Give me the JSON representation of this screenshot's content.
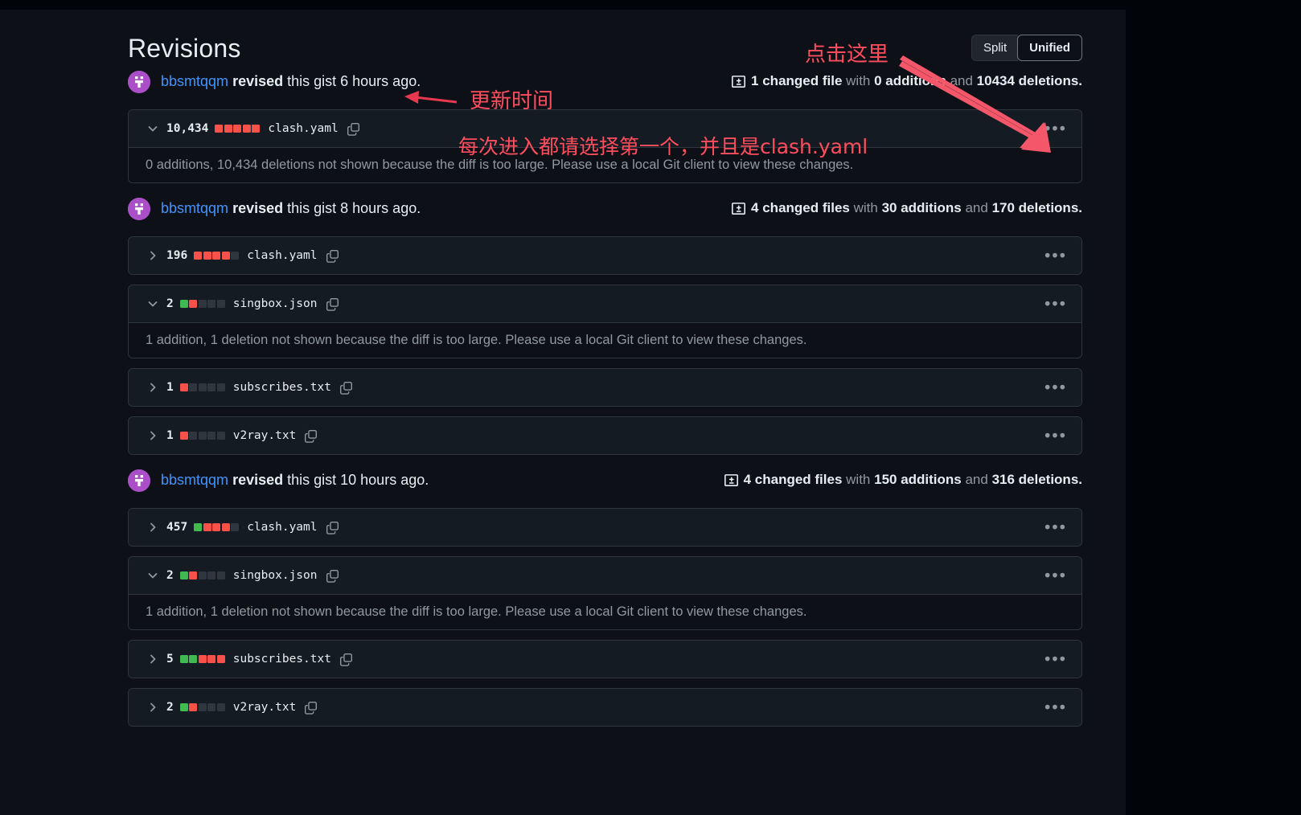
{
  "page": {
    "title": "Revisions"
  },
  "view_toggle": {
    "split_label": "Split",
    "unified_label": "Unified",
    "active": "Unified"
  },
  "colors": {
    "background": "#0d1117",
    "surface": "#151b23",
    "border": "#30363d",
    "link": "#4493f8",
    "text": "#e6edf3",
    "muted": "#9198a1",
    "addition": "#3fb950",
    "deletion": "#f85149",
    "neutral_block": "#30363d",
    "annotation": "#ff4d5e",
    "avatar": "#a544c4"
  },
  "annotations": [
    {
      "id": "update-time",
      "text": "更新时间"
    },
    {
      "id": "click-here",
      "text": "点击这里"
    },
    {
      "id": "choose-first",
      "text": "每次进入都请选择第一个，并且是clash.yaml"
    }
  ],
  "revisions": [
    {
      "author": "bbsmtqqm",
      "action": "revised",
      "middle": " this gist ",
      "time": "6 hours ago.",
      "stat": {
        "files": "1 changed file",
        "with": " with ",
        "additions": "0 additions",
        "and": " and ",
        "deletions": "10434 deletions."
      },
      "files": [
        {
          "expanded": true,
          "count": "10,434",
          "blocks": [
            "del",
            "del",
            "del",
            "del",
            "del"
          ],
          "name": "clash.yaml",
          "message": "0 additions, 10,434 deletions not shown because the diff is too large. Please use a local Git client to view these changes."
        }
      ]
    },
    {
      "author": "bbsmtqqm",
      "action": "revised",
      "middle": " this gist ",
      "time": "8 hours ago.",
      "stat": {
        "files": "4 changed files",
        "with": " with ",
        "additions": "30 additions",
        "and": " and ",
        "deletions": "170 deletions."
      },
      "files": [
        {
          "expanded": false,
          "count": "196",
          "blocks": [
            "del",
            "del",
            "del",
            "del",
            "neu"
          ],
          "name": "clash.yaml",
          "message": null
        },
        {
          "expanded": true,
          "count": "2",
          "blocks": [
            "add",
            "del",
            "neu",
            "neu",
            "neu"
          ],
          "name": "singbox.json",
          "message": "1 addition, 1 deletion not shown because the diff is too large. Please use a local Git client to view these changes."
        },
        {
          "expanded": false,
          "count": "1",
          "blocks": [
            "del",
            "neu",
            "neu",
            "neu",
            "neu"
          ],
          "name": "subscribes.txt",
          "message": null
        },
        {
          "expanded": false,
          "count": "1",
          "blocks": [
            "del",
            "neu",
            "neu",
            "neu",
            "neu"
          ],
          "name": "v2ray.txt",
          "message": null
        }
      ]
    },
    {
      "author": "bbsmtqqm",
      "action": "revised",
      "middle": " this gist ",
      "time": "10 hours ago.",
      "stat": {
        "files": "4 changed files",
        "with": " with ",
        "additions": "150 additions",
        "and": " and ",
        "deletions": "316 deletions."
      },
      "files": [
        {
          "expanded": false,
          "count": "457",
          "blocks": [
            "add",
            "del",
            "del",
            "del",
            "neu"
          ],
          "name": "clash.yaml",
          "message": null
        },
        {
          "expanded": true,
          "count": "2",
          "blocks": [
            "add",
            "del",
            "neu",
            "neu",
            "neu"
          ],
          "name": "singbox.json",
          "message": "1 addition, 1 deletion not shown because the diff is too large. Please use a local Git client to view these changes."
        },
        {
          "expanded": false,
          "count": "5",
          "blocks": [
            "add",
            "add",
            "del",
            "del",
            "del"
          ],
          "name": "subscribes.txt",
          "message": null
        },
        {
          "expanded": false,
          "count": "2",
          "blocks": [
            "add",
            "del",
            "neu",
            "neu",
            "neu"
          ],
          "name": "v2ray.txt",
          "message": null
        }
      ]
    }
  ],
  "kebab_label": "•••"
}
